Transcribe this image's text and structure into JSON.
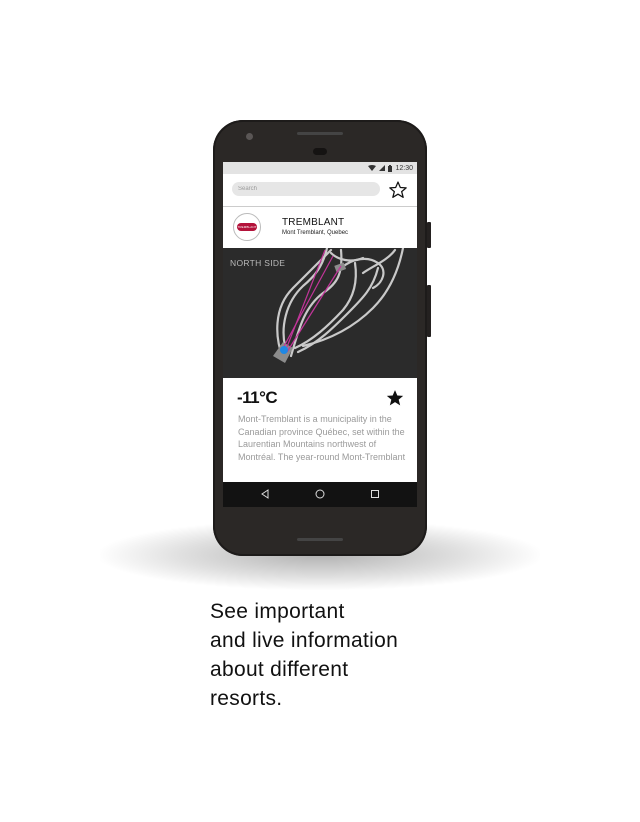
{
  "status_bar": {
    "time": "12:30"
  },
  "search": {
    "placeholder": "Search"
  },
  "resort": {
    "name": "TREMBLANT",
    "location": "Mont Tremblant, Quebec",
    "logo_text": "TREMBLANT",
    "map_label": "NORTH SIDE",
    "temperature": "-11°C",
    "favorited": true,
    "description": "Mont-Tremblant is a municipality in the Canadian province Québec, set within the Laurentian Mountains northwest of Montréal. The year-round Mont-Tremblant"
  },
  "navigation": [
    "back",
    "home",
    "recents"
  ],
  "caption": {
    "line1": "See important",
    "line2": "and live information",
    "line3": "about different",
    "line4": "resorts."
  },
  "colors": {
    "brand": "#b3123a",
    "lift_line": "#c2359a",
    "map_background": "#2b2b2b",
    "trail": "#c9c9c9",
    "location_dot": "#1e88e5"
  }
}
